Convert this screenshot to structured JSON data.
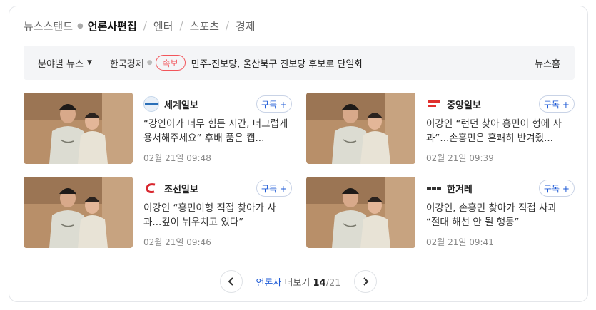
{
  "topnav": {
    "items": [
      "뉴스스탠드",
      "언론사편집",
      "엔터",
      "스포츠",
      "경제"
    ],
    "active_index": 1
  },
  "filter": {
    "category_label": "분야별 뉴스",
    "press": "한국경제",
    "badge": "속보",
    "headline": "민주-진보당, 울산북구 진보당 후보로 단일화",
    "home_link": "뉴스홈"
  },
  "news": [
    {
      "press": "세계일보",
      "logo_text": "세계일보",
      "logo_color": "#2a6fb8",
      "subscribe": "구독 +",
      "title": "“강인이가 너무 힘든 시간, 너그럽게 용서해주세요” 후배 품은 캡...",
      "time": "02월 21일 09:48"
    },
    {
      "press": "중앙일보",
      "logo_text": "The JoongAng",
      "logo_color": "#e0302e",
      "subscribe": "구독 +",
      "title": "이강인 “런던 찾아 흥민이 형에 사과”...손흥민은 흔쾌히 반겨줬...",
      "time": "02월 21일 09:39"
    },
    {
      "press": "조선일보",
      "logo_text": "C",
      "logo_color": "#d8262e",
      "subscribe": "구독 +",
      "title": "이강인 “흥민이형 직접 찾아가 사과...깊이 뉘우치고 있다”",
      "time": "02월 21일 09:46"
    },
    {
      "press": "한겨레",
      "logo_text": "한겨레",
      "logo_color": "#333333",
      "subscribe": "구독 +",
      "title": "이강인, 손흥민 찾아가 직접 사과 “절대 해선 안 될 행동”",
      "time": "02월 21일 09:41"
    }
  ],
  "pager": {
    "press_label": "언론사",
    "more_label": "더보기",
    "current": "14",
    "total": "/21",
    "prev_icon": "chevron-left-icon",
    "next_icon": "chevron-right-icon"
  },
  "colors": {
    "accent_blue": "#1d5ad6",
    "badge_red": "#f2555b",
    "filter_bg": "#f4f5f7"
  }
}
